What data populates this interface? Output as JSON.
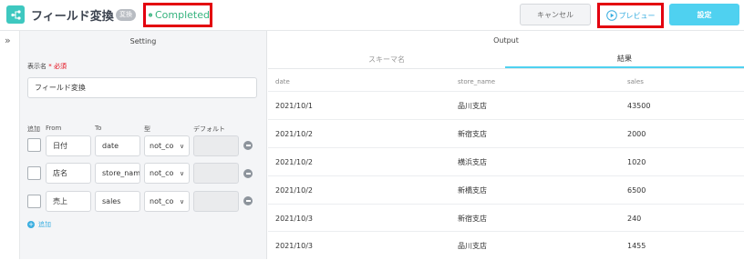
{
  "header": {
    "title": "フィールド変換",
    "type_badge": "変換",
    "status": "Completed",
    "cancel_label": "キャンセル",
    "preview_label": "プレビュー",
    "settings_label": "設定"
  },
  "colors": {
    "accent": "#4fd1f0",
    "success": "#36b37e",
    "highlight_border": "#e3000f",
    "app_icon": "#3ec8c0"
  },
  "setting": {
    "title": "Setting",
    "display_name_label": "表示名",
    "required_label": "* 必須",
    "display_name_value": "フィールド変換",
    "columns": {
      "add": "追加",
      "from": "From",
      "to": "To",
      "type": "型",
      "default": "デフォルト"
    },
    "rows": [
      {
        "from": "日付",
        "to": "date",
        "type": "not_co"
      },
      {
        "from": "店名",
        "to": "store_nam",
        "type": "not_co"
      },
      {
        "from": "売上",
        "to": "sales",
        "type": "not_co"
      }
    ],
    "add_label": "追加"
  },
  "output": {
    "title": "Output",
    "tabs": {
      "schema": "スキーマ名",
      "result": "結果"
    },
    "headers": {
      "date": "date",
      "store": "store_name",
      "sales": "sales"
    },
    "rows": [
      {
        "date": "2021/10/1",
        "store": "品川支店",
        "sales": "43500"
      },
      {
        "date": "2021/10/2",
        "store": "新宿支店",
        "sales": "2000"
      },
      {
        "date": "2021/10/2",
        "store": "横浜支店",
        "sales": "1020"
      },
      {
        "date": "2021/10/2",
        "store": "新橋支店",
        "sales": "6500"
      },
      {
        "date": "2021/10/3",
        "store": "新宿支店",
        "sales": "240"
      },
      {
        "date": "2021/10/3",
        "store": "品川支店",
        "sales": "1455"
      }
    ]
  }
}
